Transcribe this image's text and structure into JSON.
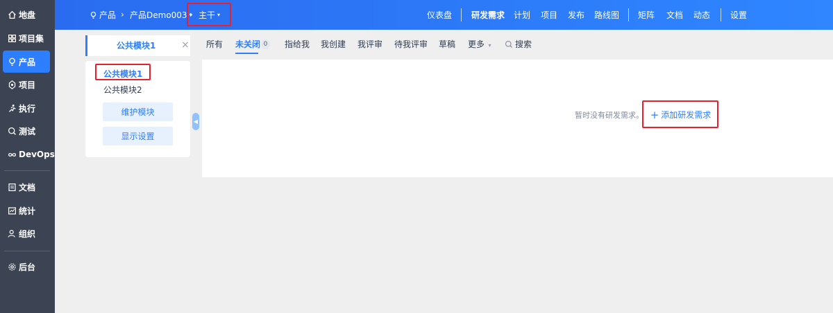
{
  "sidebar": {
    "items": [
      {
        "label": "地盘",
        "icon": "home-icon"
      },
      {
        "label": "项目集",
        "icon": "grid-icon"
      },
      {
        "label": "产品",
        "icon": "bulb-icon",
        "active": true
      },
      {
        "label": "项目",
        "icon": "project-icon"
      },
      {
        "label": "执行",
        "icon": "run-icon"
      },
      {
        "label": "测试",
        "icon": "test-icon"
      },
      {
        "label": "DevOps",
        "icon": "infinity-icon"
      },
      {
        "label": "文档",
        "icon": "doc-icon"
      },
      {
        "label": "统计",
        "icon": "chart-icon"
      },
      {
        "label": "组织",
        "icon": "user-icon"
      },
      {
        "label": "后台",
        "icon": "gear-icon"
      }
    ]
  },
  "header": {
    "breadcrumb": {
      "product_section": "产品",
      "product_name": "产品Demo003",
      "branch": "主干"
    },
    "nav": [
      "仪表盘",
      "研发需求",
      "计划",
      "项目",
      "发布",
      "路线图",
      "矩阵",
      "文档",
      "动态",
      "设置"
    ],
    "active_nav": "研发需求"
  },
  "module_panel": {
    "tab_label": "公共模块1",
    "tree": [
      "公共模块1",
      "公共模块2"
    ],
    "maintain_button": "维护模块",
    "display_settings_button": "显示设置"
  },
  "filter_tabs": {
    "items": [
      "所有",
      "未关闭",
      "指给我",
      "我创建",
      "我评审",
      "待我评审",
      "草稿",
      "更多",
      "搜索"
    ],
    "active": "未关闭",
    "active_count": "0"
  },
  "main": {
    "empty_text": "暂时没有研发需求。",
    "add_button": "添加研发需求"
  },
  "colors": {
    "accent": "#2e7fff",
    "sidebar_bg": "#3c4353",
    "highlight_box": "#e8202e"
  }
}
